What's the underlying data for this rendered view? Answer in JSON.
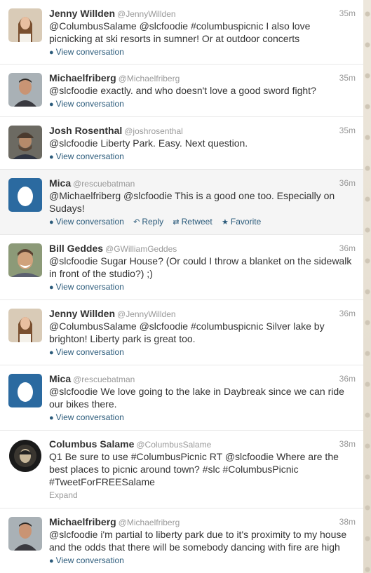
{
  "tweets": [
    {
      "name": "Jenny Willden",
      "handle": "@JennyWillden",
      "time": "35m",
      "text": "@ColumbusSalame @slcfoodie #columbuspicnic I also love picnicking at ski resorts in sumner! Or at outdoor concerts",
      "link": "View conversation",
      "avatar": "jenny"
    },
    {
      "name": "Michaelfriberg",
      "handle": "@Michaelfriberg",
      "time": "35m",
      "text": "@slcfoodie exactly. and who doesn't love a good sword fight?",
      "link": "View conversation",
      "avatar": "michael"
    },
    {
      "name": "Josh Rosenthal",
      "handle": "@joshrosenthal",
      "time": "35m",
      "text": "@slcfoodie Liberty Park. Easy. Next question.",
      "link": "View conversation",
      "avatar": "josh"
    },
    {
      "name": "Mica",
      "handle": "@rescuebatman",
      "time": "36m",
      "text": "@Michaelfriberg @slcfoodie This is a good one too. Especially on Sudays!",
      "link": "View conversation",
      "reply": "Reply",
      "retweet": "Retweet",
      "favorite": "Favorite",
      "avatar": "egg"
    },
    {
      "name": "Bill Geddes",
      "handle": "@GWilliamGeddes",
      "time": "36m",
      "text": "@slcfoodie Sugar House? (Or could I throw a blanket on the sidewalk in front of the studio?) ;)",
      "link": "View conversation",
      "avatar": "bill"
    },
    {
      "name": "Jenny Willden",
      "handle": "@JennyWillden",
      "time": "36m",
      "text": "@ColumbusSalame @slcfoodie #columbuspicnic Silver lake by brighton! Liberty park is great too.",
      "link": "View conversation",
      "avatar": "jenny"
    },
    {
      "name": "Mica",
      "handle": "@rescuebatman",
      "time": "36m",
      "text": "@slcfoodie We love going to the lake in Daybreak since we can ride our bikes there.",
      "link": "View conversation",
      "avatar": "egg"
    },
    {
      "name": "Columbus Salame",
      "handle": "@ColumbusSalame",
      "time": "38m",
      "text": "Q1 Be sure to use #ColumbusPicnic RT @slcfoodie Where are the best places to picnic around town? #slc #ColumbusPicnic #TweetForFREESalame",
      "expand": "Expand",
      "avatar": "columbus"
    },
    {
      "name": "Michaelfriberg",
      "handle": "@Michaelfriberg",
      "time": "38m",
      "text": "@slcfoodie i'm partial to liberty park due to it's proximity to my house and the odds that there will be somebody dancing with fire are high",
      "link": "View conversation",
      "avatar": "michael"
    }
  ],
  "icons": {
    "conversation": "speech-bubble-icon",
    "reply": "reply-arrow-icon",
    "retweet": "retweet-icon",
    "favorite": "star-icon"
  },
  "colors": {
    "link": "#2a5a7a",
    "name": "#333333",
    "meta": "#999999",
    "egg_bg": "#2b6aa0",
    "highlight": "#f5f5f5"
  }
}
